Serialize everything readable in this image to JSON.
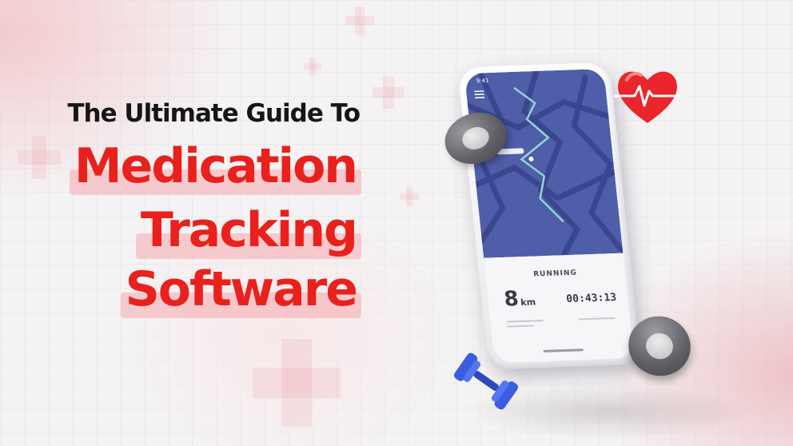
{
  "headline": {
    "subtitle": "The Ultimate Guide To",
    "title_lines": [
      "Medication",
      "Tracking",
      "Software"
    ]
  },
  "phone": {
    "status_time": "9:41",
    "activity_label": "RUNNING",
    "distance_value": "8",
    "distance_unit": "km",
    "duration": "00:43:13"
  },
  "colors": {
    "title_red": "#e8211d",
    "title_highlight": "#f5aaaf",
    "subtitle_dark": "#161616",
    "map_blue": "#4f5ea8",
    "route_teal": "#8fd6d0",
    "heart_red": "#e8262b",
    "dumbbell_blue": "#3a5ee0"
  },
  "icons": [
    "plus-icon",
    "menu-icon",
    "fitness-disc-icon",
    "heart-pulse-icon",
    "dumbbell-icon"
  ]
}
